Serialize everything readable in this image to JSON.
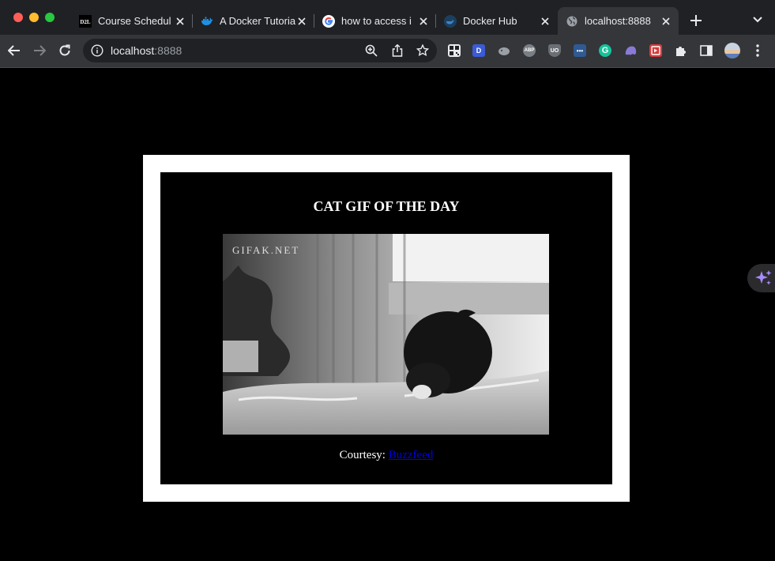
{
  "browser": {
    "tabs": [
      {
        "title": "Course Schedul",
        "favicon": "d2l-icon",
        "favicon_text": "D2L",
        "active": false
      },
      {
        "title": "A Docker Tutoria",
        "favicon": "docker-icon",
        "active": false
      },
      {
        "title": "how to access i",
        "favicon": "google-icon",
        "active": false
      },
      {
        "title": "Docker Hub",
        "favicon": "docker-hub-icon",
        "active": false
      },
      {
        "title": "localhost:8888",
        "favicon": "globe-icon",
        "active": true
      }
    ],
    "address_bar": {
      "host": "localhost",
      "port": ":8888"
    },
    "extensions": [
      {
        "name": "qr-code-extension-icon",
        "label": "",
        "color": "#e8eaed"
      },
      {
        "name": "d-extension-icon",
        "label": "D",
        "color": "#3b5bd6"
      },
      {
        "name": "fish-extension-icon",
        "label": "",
        "color": "#9aa0a6"
      },
      {
        "name": "adblock-plus-icon",
        "label": "ABP",
        "color": "#7a7f86"
      },
      {
        "name": "ublock-icon",
        "label": "UO",
        "color": "#6b6f75"
      },
      {
        "name": "dots-extension-icon",
        "label": "•••",
        "color": "#2f5a93"
      },
      {
        "name": "grammarly-icon",
        "label": "G",
        "color": "#15c39a"
      },
      {
        "name": "ghost-extension-icon",
        "label": "",
        "color": "#8a7ad6"
      },
      {
        "name": "video-extension-icon",
        "label": "",
        "color": "#d93a3a"
      }
    ],
    "colors": {
      "tabstrip": "#202124",
      "toolbar": "#35363a",
      "accent_fab": "#a78bfa"
    }
  },
  "page": {
    "heading": "CAT GIF OF THE DAY",
    "gif_watermark": "GIFAK.NET",
    "courtesy_label": "Courtesy:",
    "courtesy_link": "Buzzfeed"
  }
}
